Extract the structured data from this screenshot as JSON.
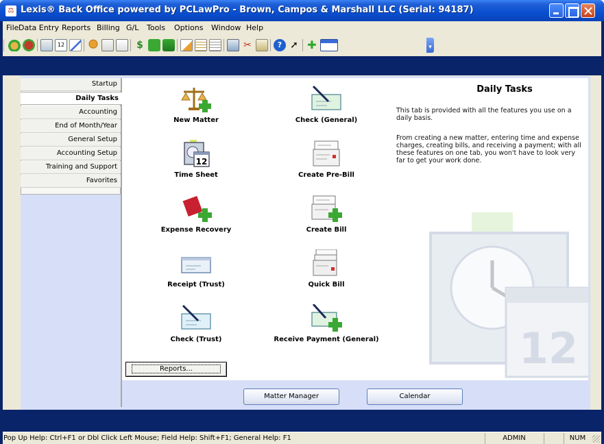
{
  "window": {
    "title": "Lexis® Back Office powered by PCLawPro - Brown, Campos & Marshall LLC (Serial:  94187)",
    "app_icon": "pclaw-app-icon",
    "controls": [
      "minimize",
      "maximize",
      "close"
    ]
  },
  "menubar": {
    "items": [
      {
        "label": "File"
      },
      {
        "label": "Data Entry"
      },
      {
        "label": "Reports"
      },
      {
        "label": "Billing"
      },
      {
        "label": "G/L"
      },
      {
        "label": "Tools"
      },
      {
        "label": "Options"
      },
      {
        "label": "Window"
      },
      {
        "label": "Help"
      }
    ]
  },
  "toolbar": {
    "icons": [
      "new-matter-icon",
      "expense-icon",
      "time-sheet-icon",
      "calendar-icon",
      "edit-icon",
      "scales-icon",
      "bill-icon",
      "prebill-icon",
      "money-icon",
      "book-icon",
      "receipt-icon",
      "note-icon",
      "report-icon",
      "document-icon",
      "share-icon",
      "cut-icon",
      "clipboard-icon",
      "help-icon",
      "whats-this-icon",
      "add-icon",
      "window-icon"
    ]
  },
  "sidebar": {
    "items": [
      {
        "label": "Startup",
        "active": false
      },
      {
        "label": "Daily Tasks",
        "active": true
      },
      {
        "label": "Accounting",
        "active": false
      },
      {
        "label": "End of Month/Year",
        "active": false
      },
      {
        "label": "General Setup",
        "active": false
      },
      {
        "label": "Accounting Setup",
        "active": false
      },
      {
        "label": "Training and Support",
        "active": false
      },
      {
        "label": "Favorites",
        "active": false
      }
    ]
  },
  "tasks": [
    {
      "label": "New Matter",
      "icon": "scales-plus-icon"
    },
    {
      "label": "Check (General)",
      "icon": "check-pen-icon"
    },
    {
      "label": "Time Sheet",
      "icon": "clock-calendar-icon"
    },
    {
      "label": "Create Pre-Bill",
      "icon": "prebill-icon"
    },
    {
      "label": "Expense Recovery",
      "icon": "expense-plus-icon"
    },
    {
      "label": "Create Bill",
      "icon": "bill-plus-icon"
    },
    {
      "label": "Receipt (Trust)",
      "icon": "receipt-icon"
    },
    {
      "label": "Quick Bill",
      "icon": "quick-bill-icon"
    },
    {
      "label": "Check (Trust)",
      "icon": "check-pen-icon"
    },
    {
      "label": "Receive Payment (General)",
      "icon": "payment-plus-icon"
    }
  ],
  "info": {
    "title": "Daily Tasks",
    "desc1": "This tab is provided with all the features you use on a daily basis.",
    "desc2": "From creating a new matter, entering time and expense charges, creating bills, and receiving a payment; with all these features on one tab, you won't have to look very far to get your work done."
  },
  "buttons": {
    "reports": "Reports...",
    "matter_manager": "Matter Manager",
    "calendar": "Calendar"
  },
  "time_sheet_icon_day": "12",
  "watermark_day": "12",
  "statusbar": {
    "help": "Pop Up Help: Ctrl+F1 or Dbl Click Left Mouse; Field Help: Shift+F1; General Help: F1",
    "user": "ADMIN",
    "num": "NUM"
  },
  "colors": {
    "frame": "#0a246a",
    "titlebar": "#0a4fd0",
    "panel": "#d6dff7",
    "accent_green": "#3aa832"
  }
}
